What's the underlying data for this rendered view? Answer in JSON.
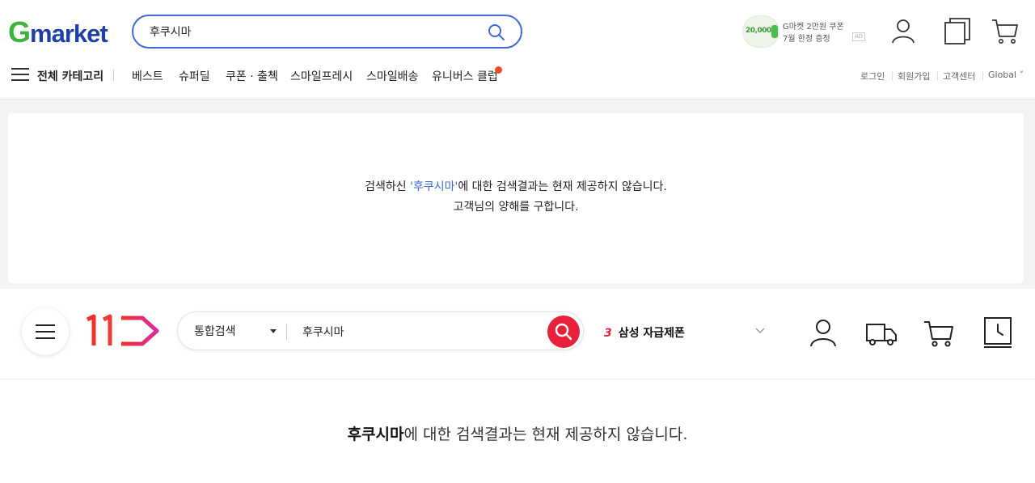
{
  "gmarket": {
    "logo_g": "G",
    "logo_rest": "market",
    "search_value": "후쿠시마",
    "promo": {
      "amount": "20,000",
      "line1": "G마켓 2만원 쿠폰",
      "line2": "7월 한정 증정",
      "ad": "AD"
    },
    "nav": {
      "all_categories": "전체 카테고리",
      "items": [
        "베스트",
        "슈퍼딜",
        "쿠폰 · 출첵",
        "스마일프레시",
        "스마일배송",
        "유니버스 클럽"
      ]
    },
    "util": [
      "로그인",
      "회원가입",
      "고객센터",
      "Global ˅"
    ],
    "message": {
      "prefix": "검색하신 ",
      "query": "'후쿠시마'",
      "suffix": "에 대한 검색결과는 현재 제공하지 않습니다.",
      "line2": "고객님의 양해를 구합니다."
    },
    "colors": {
      "accent": "#3f68d8",
      "logo_green": "#3fb13f",
      "logo_blue": "#1e3fa8"
    }
  },
  "st11": {
    "search_scope": "통합검색",
    "search_value": "후쿠시마",
    "rank_number": "3",
    "rank_keyword": "삼성 자급제폰",
    "message": {
      "query": "후쿠시마",
      "suffix": "에 대한 검색결과는 현재 제공하지 않습니다."
    },
    "icons": [
      "menu-icon",
      "user-icon",
      "truck-icon",
      "cart-icon",
      "recent-clock-icon"
    ],
    "colors": {
      "accent": "#e8203a",
      "logo_gradient_end": "#d62da0"
    }
  }
}
